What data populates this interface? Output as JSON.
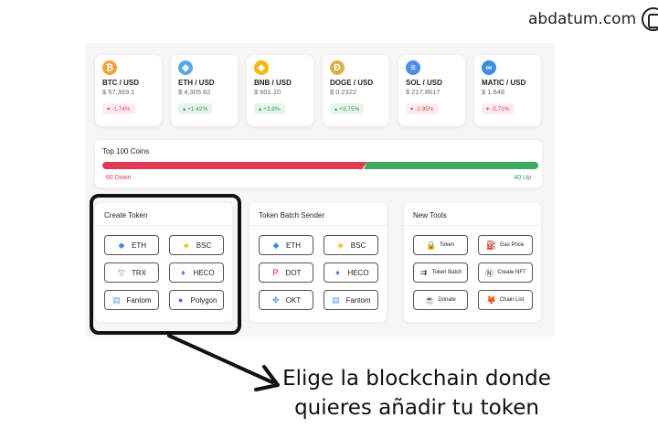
{
  "brand": {
    "name": "abdatum.com"
  },
  "coins": [
    {
      "pair": "BTC / USD",
      "price": "$ 57,369.1",
      "change": "-1.74%",
      "direction": "down",
      "symbol": "₿",
      "color": "#f2a33a",
      "icon": "bitcoin-icon"
    },
    {
      "pair": "ETH / USD",
      "price": "$ 4,305.62",
      "change": "+1.42%",
      "direction": "up",
      "symbol": "◆",
      "color": "#5aa9e6",
      "icon": "ethereum-icon"
    },
    {
      "pair": "BNB / USD",
      "price": "$ 601.10",
      "change": "+3.8%",
      "direction": "up",
      "symbol": "◈",
      "color": "#f0b90b",
      "icon": "bnb-icon"
    },
    {
      "pair": "DOGE / USD",
      "price": "$ 0.2322",
      "change": "+3.75%",
      "direction": "up",
      "symbol": "Ð",
      "color": "#d8b546",
      "icon": "doge-icon"
    },
    {
      "pair": "SOL / USD",
      "price": "$ 217.8617",
      "change": "-1.95%",
      "direction": "down",
      "symbol": "≡",
      "color": "#4f8de8",
      "icon": "solana-icon"
    },
    {
      "pair": "MATIC / USD",
      "price": "$ 1.648",
      "change": "-5.71%",
      "direction": "down",
      "symbol": "∞",
      "color": "#3b8de3",
      "icon": "polygon-icon"
    }
  ],
  "top100": {
    "title": "Top 100 Coins",
    "down_label": "60 Down",
    "up_label": "40 Up",
    "down_count": 60,
    "up_count": 40
  },
  "panels": [
    {
      "title": "Create Token",
      "buttons": [
        {
          "label": "ETH",
          "symbol": "◆",
          "color": "#3b8de3"
        },
        {
          "label": "BSC",
          "symbol": "◈",
          "color": "#f0b90b"
        },
        {
          "label": "TRX",
          "symbol": "▽",
          "color": "#d9434b"
        },
        {
          "label": "HECO",
          "symbol": "♦",
          "color": "#4b7fd8"
        },
        {
          "label": "Fantom",
          "symbol": "▤",
          "color": "#5a9be0"
        },
        {
          "label": "Polygon",
          "symbol": "●",
          "color": "#7d4ce3"
        }
      ]
    },
    {
      "title": "Token Batch Sender",
      "buttons": [
        {
          "label": "ETH",
          "symbol": "◆",
          "color": "#3b8de3"
        },
        {
          "label": "BSC",
          "symbol": "◈",
          "color": "#f0b90b"
        },
        {
          "label": "DOT",
          "symbol": "P",
          "color": "#e6007a"
        },
        {
          "label": "HECO",
          "symbol": "♦",
          "color": "#4b7fd8"
        },
        {
          "label": "OKT",
          "symbol": "✥",
          "color": "#4b8fe0"
        },
        {
          "label": "Fantom",
          "symbol": "▤",
          "color": "#5a9be0"
        }
      ]
    },
    {
      "title": "New Tools",
      "buttons": [
        {
          "label": "Token",
          "symbol": "🔒",
          "color": "#222"
        },
        {
          "label": "Gas Price",
          "symbol": "⛽",
          "color": "#222"
        },
        {
          "label": "Token Batch",
          "symbol": "⇉",
          "color": "#222"
        },
        {
          "label": "Create NFT",
          "symbol": "Ⓝ",
          "color": "#222"
        },
        {
          "label": "Donate",
          "symbol": "☕",
          "color": "#222"
        },
        {
          "label": "Chain List",
          "symbol": "🦊",
          "color": "#e8821e"
        }
      ]
    }
  ],
  "caption": {
    "line1": "Elige la blockchain donde",
    "line2": "quieres añadir tu token"
  }
}
